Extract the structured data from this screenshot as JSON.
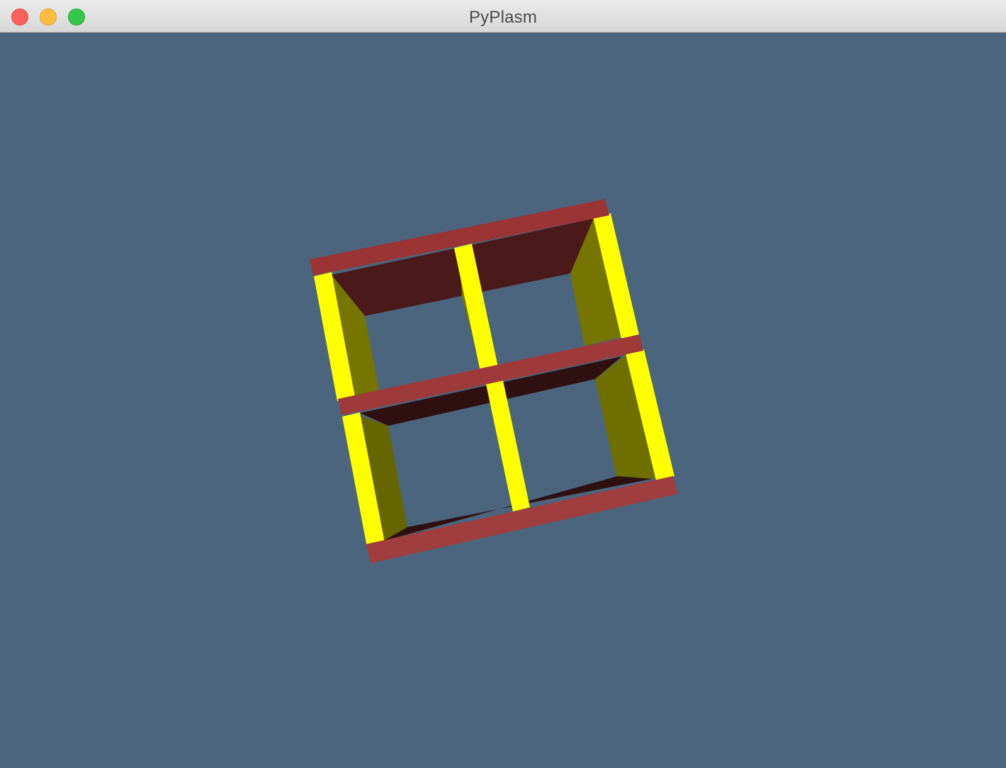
{
  "window": {
    "title": "PyPlasm",
    "controls": {
      "close": "close-button",
      "minimize": "minimize-button",
      "zoom": "zoom-button"
    }
  },
  "viewport": {
    "background": "#4c657f",
    "object": {
      "description_colors": {
        "shelf_face": "#9b3435",
        "shelf_shadow": "#4a1a1b",
        "shelf_dark": "#2f1010",
        "post_face": "#ffff00",
        "post_side": "#757500"
      }
    }
  }
}
